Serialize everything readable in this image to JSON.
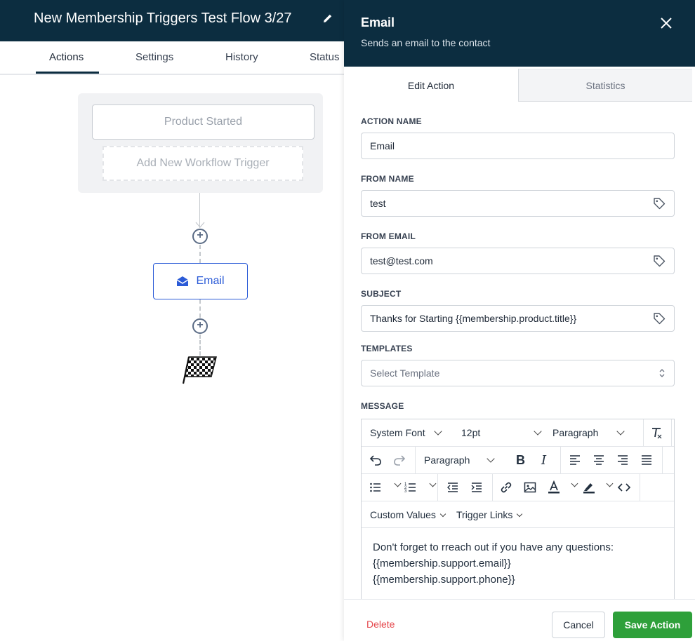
{
  "flow": {
    "title": "New Membership Triggers Test Flow 3/27",
    "tabs": [
      {
        "label": "Actions",
        "active": true
      },
      {
        "label": "Settings"
      },
      {
        "label": "History"
      },
      {
        "label": "Status"
      }
    ]
  },
  "canvas": {
    "trigger_label": "Product Started",
    "add_trigger_label": "Add New Workflow Trigger",
    "action_node_label": "Email",
    "action_node_icon": "envelope-open-icon",
    "add_step_icon": "plus-circle-icon",
    "end_icon": "checkered-flag-icon"
  },
  "panel": {
    "title": "Email",
    "subtitle": "Sends an email to the contact",
    "tabs": [
      {
        "label": "Edit Action",
        "active": true
      },
      {
        "label": "Statistics"
      }
    ],
    "fields": {
      "action_name": {
        "label": "ACTION NAME",
        "value": "Email"
      },
      "from_name": {
        "label": "FROM NAME",
        "value": "test"
      },
      "from_email": {
        "label": "FROM EMAIL",
        "value": "test@test.com"
      },
      "subject": {
        "label": "SUBJECT",
        "value": "Thanks for Starting {{membership.product.title}}"
      },
      "templates": {
        "label": "TEMPLATES",
        "placeholder": "Select Template"
      }
    },
    "message": {
      "label": "MESSAGE",
      "toolbar": {
        "font_family": "System Font",
        "font_size": "12pt",
        "block_format_1": "Paragraph",
        "block_format_2": "Paragraph"
      },
      "context_menus": {
        "custom_values": "Custom Values",
        "trigger_links": "Trigger Links"
      },
      "body_lines": [
        "Don't forget to rreach out if you have any questions:",
        "{{membership.support.email}}",
        "{{membership.support.phone}}"
      ]
    },
    "footer": {
      "delete_label": "Delete",
      "cancel_label": "Cancel",
      "save_label": "Save Action"
    }
  },
  "colors": {
    "header_bg": "#0c2d40",
    "accent_blue": "#2b5bd7",
    "save_green": "#2ea03a",
    "delete_red": "#e5484d"
  }
}
